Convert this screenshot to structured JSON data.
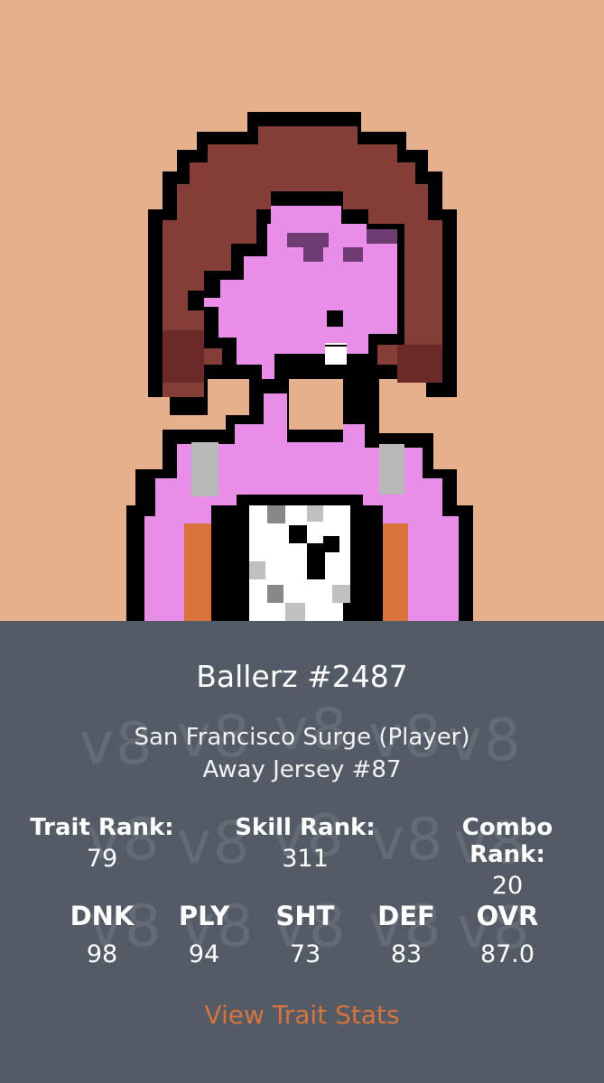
{
  "card": {
    "title": "Ballerz #2487",
    "team": "San Francisco Surge (Player)",
    "jersey": "Away Jersey #87",
    "watermark": "v8",
    "ranks": [
      {
        "label": "Trait Rank:",
        "value": "79"
      },
      {
        "label": "Skill Rank:",
        "value": "311"
      },
      {
        "label": "Combo Rank:",
        "value": "20"
      }
    ],
    "stats": [
      {
        "label": "DNK",
        "value": "98"
      },
      {
        "label": "PLY",
        "value": "94"
      },
      {
        "label": "SHT",
        "value": "73"
      },
      {
        "label": "DEF",
        "value": "83"
      },
      {
        "label": "OVR",
        "value": "87.0"
      }
    ],
    "link": "View Trait Stats"
  },
  "colors": {
    "background": "#e6b08c",
    "panel": "#525b66",
    "skin": "#e98ee8",
    "hair": "#853d38",
    "hair_shadow": "#6b2a28",
    "link": "#d9733a"
  }
}
